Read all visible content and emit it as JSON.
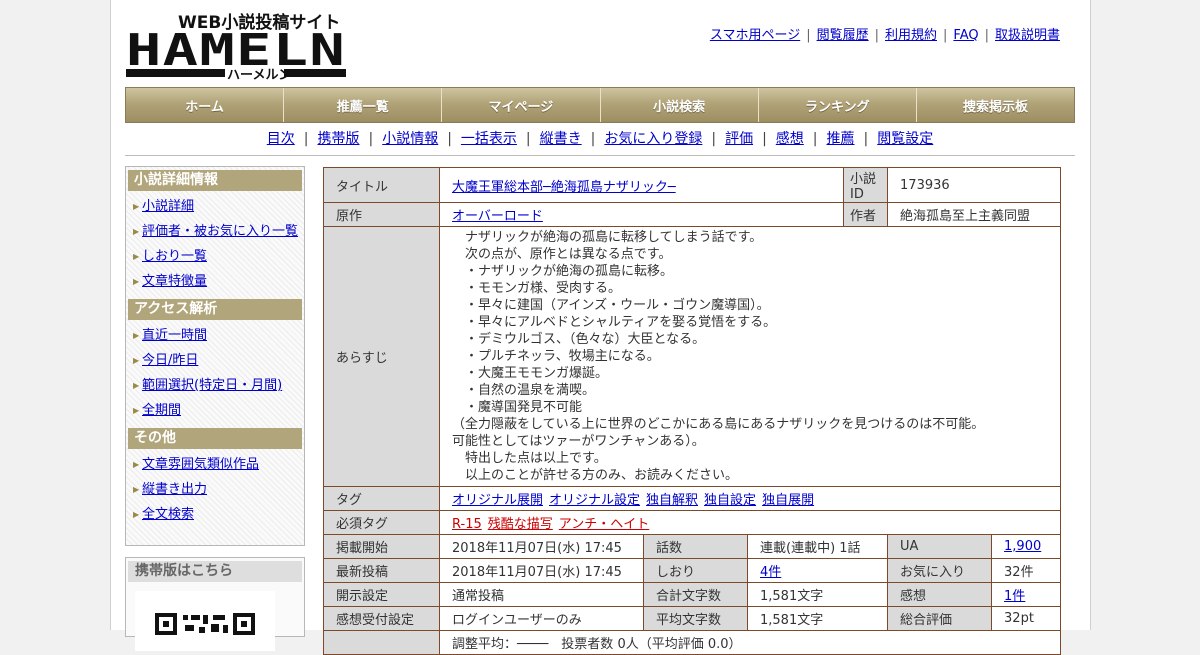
{
  "header": {
    "logo_tagline": "WEB小説投稿サイト",
    "logo_main": "HAMELN",
    "logo_kana": "ハーメルン",
    "top_links": [
      "スマホ用ページ",
      "閲覧履歴",
      "利用規約",
      "FAQ",
      "取扱説明書"
    ]
  },
  "nav": {
    "items": [
      "ホーム",
      "推薦一覧",
      "マイページ",
      "小説検索",
      "ランキング",
      "捜索掲示板"
    ]
  },
  "subnav": {
    "items": [
      "目次",
      "携帯版",
      "小説情報",
      "一括表示",
      "縦書き",
      "お気に入り登録",
      "評価",
      "感想",
      "推薦",
      "閲覧設定"
    ]
  },
  "sidebar": {
    "section1": {
      "title": "小説詳細情報",
      "items": [
        "小説詳細",
        "評価者・被お気に入り一覧",
        "しおり一覧",
        "文章特徴量"
      ]
    },
    "section2": {
      "title": "アクセス解析",
      "items": [
        "直近一時間",
        "今日/昨日",
        "範囲選択(特定日・月間)",
        "全期間"
      ]
    },
    "section3": {
      "title": "その他",
      "items": [
        "文章雰囲気類似作品",
        "縦書き出力",
        "全文検索"
      ]
    },
    "mobile_title": "携帯版はこちら"
  },
  "info": {
    "title_label": "タイトル",
    "title_value": "大魔王軍総本部─絶海孤島ナザリック─",
    "id_label": "小説ID",
    "id_value": "173936",
    "original_label": "原作",
    "original_value": "オーバーロード",
    "author_label": "作者",
    "author_value": "絶海孤島至上主義同盟",
    "synopsis_label": "あらすじ",
    "synopsis_lines": [
      "　ナザリックが絶海の孤島に転移してしまう話です。",
      "　次の点が、原作とは異なる点です。",
      "　・ナザリックが絶海の孤島に転移。",
      "　・モモンガ様、受肉する。",
      "　・早々に建国（アインズ・ウール・ゴウン魔導国）。",
      "　・早々にアルベドとシャルティアを娶る覚悟をする。",
      "　・デミウルゴス、（色々な）大臣となる。",
      "　・プルチネッラ、牧場主になる。",
      "　・大魔王モモンガ爆誕。",
      "　・自然の温泉を満喫。",
      "　・魔導国発見不可能",
      "（全力隠蔽をしている上に世界のどこかにある島にあるナザリックを見つけるのは不可能。",
      "可能性としてはツァーがワンチャンある）。",
      "　特出した点は以上です。",
      "　以上のことが許せる方のみ、お読みください。"
    ],
    "tags_label": "タグ",
    "tags": [
      "オリジナル展開",
      "オリジナル設定",
      "独自解釈",
      "独自設定",
      "独自展開"
    ],
    "required_tags_label": "必須タグ",
    "required_tags": [
      "R-15",
      "残酷な描写",
      "アンチ・ヘイト"
    ],
    "rows": [
      {
        "l1": "掲載開始",
        "v1": "2018年11月07日(水) 17:45",
        "l2": "話数",
        "v2": "連載(連載中) 1話",
        "l3": "UA",
        "v3": "1,900"
      },
      {
        "l1": "最新投稿",
        "v1": "2018年11月07日(水) 17:45",
        "l2": "しおり",
        "v2": "4件",
        "l3": "お気に入り",
        "v3": "32件"
      },
      {
        "l1": "開示設定",
        "v1": "通常投稿",
        "l2": "合計文字数",
        "v2": "1,581文字",
        "l3": "感想",
        "v3": "1件"
      },
      {
        "l1": "感想受付設定",
        "v1": "ログインユーザーのみ",
        "l2": "平均文字数",
        "v2": "1,581文字",
        "l3": "総合評価",
        "v3": "32pt"
      }
    ],
    "partial_row": "調整平均：────　投票者数 0人（平均評価 0.0）"
  },
  "colors": {
    "nav_gold": "#b1a378",
    "side_head": "#b1a57b",
    "table_border": "#7a4a2a",
    "label_bg": "#dadada",
    "link": "#0000cc",
    "required_tag": "#cc0000"
  }
}
